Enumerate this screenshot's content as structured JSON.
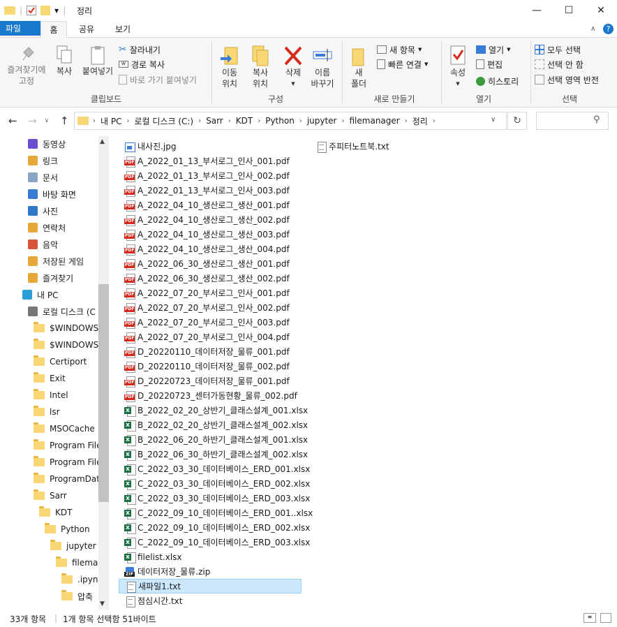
{
  "window": {
    "title": "정리"
  },
  "tabs": [
    "파일",
    "홈",
    "공유",
    "보기"
  ],
  "ribbon": {
    "clipboard": {
      "pin": "즐겨찾기에\n고정",
      "copy": "복사",
      "paste": "붙여넣기",
      "cut": "잘라내기",
      "copy_path": "경로 복사",
      "paste_shortcut": "바로 가기 붙여넣기",
      "group": "클립보드"
    },
    "organize": {
      "move_to": "이동\n위치",
      "copy_to": "복사\n위치",
      "delete": "삭제",
      "rename": "이름\n바꾸기",
      "group": "구성"
    },
    "new": {
      "new_folder": "새\n폴더",
      "new_item": "새 항목",
      "easy_access": "빠른 연결",
      "group": "새로 만들기"
    },
    "open": {
      "properties": "속성",
      "open": "열기",
      "edit": "편집",
      "history": "히스토리",
      "group": "열기"
    },
    "select": {
      "select_all": "모두 선택",
      "select_none": "선택 안 함",
      "invert": "선택 영역 반전",
      "group": "선택"
    }
  },
  "address": {
    "crumbs": [
      "내 PC",
      "로컬 디스크 (C:)",
      "Sarr",
      "KDT",
      "Python",
      "jupyter",
      "filemanager",
      "정리"
    ]
  },
  "navpane": {
    "items": [
      {
        "label": "동영상",
        "icon": "video-icon",
        "indent": 40
      },
      {
        "label": "링크",
        "icon": "link-icon",
        "indent": 40
      },
      {
        "label": "문서",
        "icon": "document-icon",
        "indent": 40
      },
      {
        "label": "바탕 화면",
        "icon": "desktop-icon",
        "indent": 40
      },
      {
        "label": "사진",
        "icon": "picture-icon",
        "indent": 40
      },
      {
        "label": "연락처",
        "icon": "contacts-icon",
        "indent": 40
      },
      {
        "label": "음악",
        "icon": "music-icon",
        "indent": 40
      },
      {
        "label": "저장된 게임",
        "icon": "saved-games-icon",
        "indent": 40
      },
      {
        "label": "즐겨찾기",
        "icon": "favorites-icon",
        "indent": 40
      },
      {
        "label": "내 PC",
        "icon": "pc-icon",
        "indent": 32
      },
      {
        "label": "로컬 디스크 (C",
        "icon": "drive-icon",
        "indent": 40
      },
      {
        "label": "$WINDOWS.",
        "icon": "folder-icon",
        "indent": 48
      },
      {
        "label": "$WINDOWS.",
        "icon": "folder-icon",
        "indent": 48
      },
      {
        "label": "Certiport",
        "icon": "folder-icon",
        "indent": 48
      },
      {
        "label": "Exit",
        "icon": "folder-icon",
        "indent": 48
      },
      {
        "label": "Intel",
        "icon": "folder-icon",
        "indent": 48
      },
      {
        "label": "lsr",
        "icon": "folder-icon",
        "indent": 48
      },
      {
        "label": "MSOCache",
        "icon": "folder-icon",
        "indent": 48
      },
      {
        "label": "Program Files",
        "icon": "folder-icon",
        "indent": 48
      },
      {
        "label": "Program Files",
        "icon": "folder-icon",
        "indent": 48
      },
      {
        "label": "ProgramData",
        "icon": "folder-icon",
        "indent": 48
      },
      {
        "label": "Sarr",
        "icon": "folder-icon",
        "indent": 48
      },
      {
        "label": "KDT",
        "icon": "folder-icon",
        "indent": 56
      },
      {
        "label": "Python",
        "icon": "folder-icon",
        "indent": 64
      },
      {
        "label": "jupyter",
        "icon": "folder-icon",
        "indent": 72
      },
      {
        "label": "filemanager",
        "icon": "folder-icon",
        "indent": 80
      },
      {
        "label": ".ipynb",
        "icon": "folder-icon",
        "indent": 88
      },
      {
        "label": "압축",
        "icon": "folder-icon",
        "indent": 88
      }
    ]
  },
  "files": {
    "column1": [
      {
        "name": "내사진.jpg",
        "type": "jpg"
      },
      {
        "name": "A_2022_01_13_부서로그_인사_001.pdf",
        "type": "pdf"
      },
      {
        "name": "A_2022_01_13_부서로그_인사_002.pdf",
        "type": "pdf"
      },
      {
        "name": "A_2022_01_13_부서로그_인사_003.pdf",
        "type": "pdf"
      },
      {
        "name": "A_2022_04_10_생산로그_생산_001.pdf",
        "type": "pdf"
      },
      {
        "name": "A_2022_04_10_생산로그_생산_002.pdf",
        "type": "pdf"
      },
      {
        "name": "A_2022_04_10_생산로그_생산_003.pdf",
        "type": "pdf"
      },
      {
        "name": "A_2022_04_10_생산로그_생산_004.pdf",
        "type": "pdf"
      },
      {
        "name": "A_2022_06_30_생산로그_생산_001.pdf",
        "type": "pdf"
      },
      {
        "name": "A_2022_06_30_생산로그_생산_002.pdf",
        "type": "pdf"
      },
      {
        "name": "A_2022_07_20_부서로그_인사_001.pdf",
        "type": "pdf"
      },
      {
        "name": "A_2022_07_20_부서로그_인사_002.pdf",
        "type": "pdf"
      },
      {
        "name": "A_2022_07_20_부서로그_인사_003.pdf",
        "type": "pdf"
      },
      {
        "name": "A_2022_07_20_부서로그_인사_004.pdf",
        "type": "pdf"
      },
      {
        "name": "D_20220110_데이터저장_물류_001.pdf",
        "type": "pdf"
      },
      {
        "name": "D_20220110_데이터저장_물류_002.pdf",
        "type": "pdf"
      },
      {
        "name": "D_20220723_데이터저장_물류_001.pdf",
        "type": "pdf"
      },
      {
        "name": "D_20220723_센터가동현황_물류_002.pdf",
        "type": "pdf"
      },
      {
        "name": "B_2022_02_20_상반기_클래스설계_001.xlsx",
        "type": "xls"
      },
      {
        "name": "B_2022_02_20_상반기_클래스설계_002.xlsx",
        "type": "xls"
      },
      {
        "name": "B_2022_06_20_하반기_클래스설계_001.xlsx",
        "type": "xls"
      },
      {
        "name": "B_2022_06_30_하반기_클래스설계_002.xlsx",
        "type": "xls"
      },
      {
        "name": "C_2022_03_30_데이터베이스_ERD_001.xlsx",
        "type": "xls"
      },
      {
        "name": "C_2022_03_30_데이터베이스_ERD_002.xlsx",
        "type": "xls"
      },
      {
        "name": "C_2022_03_30_데이터베이스_ERD_003.xlsx",
        "type": "xls"
      },
      {
        "name": "C_2022_09_10_데이터베이스_ERD_001..xlsx",
        "type": "xls"
      },
      {
        "name": "C_2022_09_10_데이터베이스_ERD_002.xlsx",
        "type": "xls"
      },
      {
        "name": "C_2022_09_10_데이터베이스_ERD_003.xlsx",
        "type": "xls"
      },
      {
        "name": "filelist.xlsx",
        "type": "xls"
      },
      {
        "name": "데이터저장_물류.zip",
        "type": "zip"
      },
      {
        "name": "새파일1.txt",
        "type": "txt",
        "selected": true
      },
      {
        "name": "점심시간.txt",
        "type": "txt"
      }
    ],
    "column2": [
      {
        "name": "주피터노트북.txt",
        "type": "txt"
      }
    ]
  },
  "status": {
    "count": "33개 항목",
    "selection": "1개 항목 선택함 51바이트"
  },
  "colors": {
    "accent": "#1979ca",
    "selection": "#cce8ff"
  }
}
